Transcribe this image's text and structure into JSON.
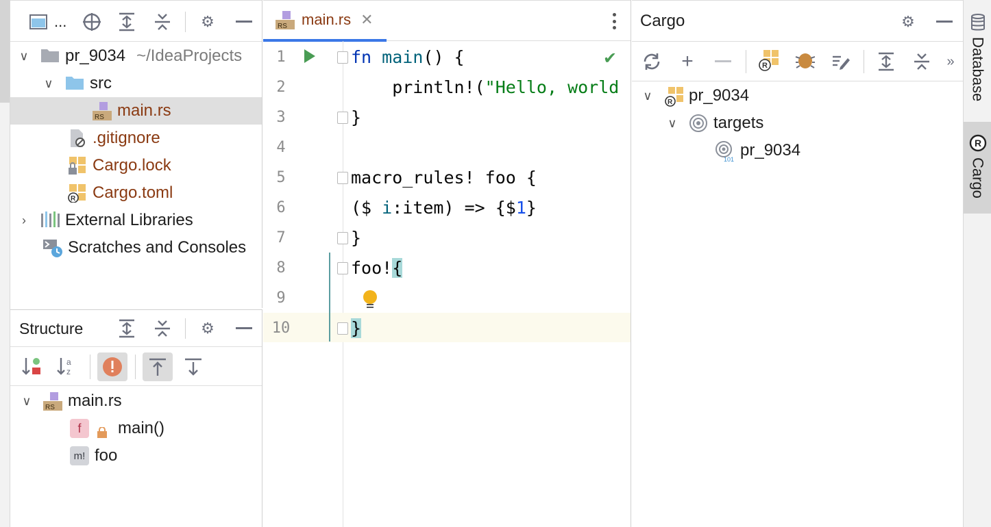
{
  "project": {
    "title": "...",
    "tree": [
      {
        "label": "pr_9034",
        "hint": "~/IdeaProjects",
        "kind": "module"
      },
      {
        "label": "src",
        "kind": "folder"
      },
      {
        "label": "main.rs",
        "kind": "rs"
      },
      {
        "label": ".gitignore",
        "kind": "ignore"
      },
      {
        "label": "Cargo.lock",
        "kind": "lock"
      },
      {
        "label": "Cargo.toml",
        "kind": "toml"
      },
      {
        "label": "External Libraries",
        "kind": "libs"
      },
      {
        "label": "Scratches and Consoles",
        "kind": "scratch"
      }
    ]
  },
  "structure": {
    "title": "Structure",
    "tree": [
      {
        "label": "main.rs"
      },
      {
        "label": "main()",
        "badge": "f"
      },
      {
        "label": "foo",
        "badge": "m!"
      }
    ]
  },
  "editor": {
    "tab": "main.rs",
    "tab_icon_text": "RS",
    "lines": [
      "1",
      "2",
      "3",
      "4",
      "5",
      "6",
      "7",
      "8",
      "9",
      "10"
    ]
  },
  "cargo": {
    "title": "Cargo",
    "tree": [
      {
        "label": "pr_9034"
      },
      {
        "label": "targets"
      },
      {
        "label": "pr_9034"
      }
    ],
    "target_icon_text": "101"
  },
  "right_strip": {
    "tabs": [
      "Database",
      "Cargo"
    ]
  },
  "icons": {
    "rs_badge_text": "RS",
    "rust_logo_text": "R"
  },
  "colors": {
    "accent": "#3b78e7",
    "run": "#499c54",
    "modified_file": "#8a3a12",
    "match_highlight": "#a8d9d9"
  }
}
